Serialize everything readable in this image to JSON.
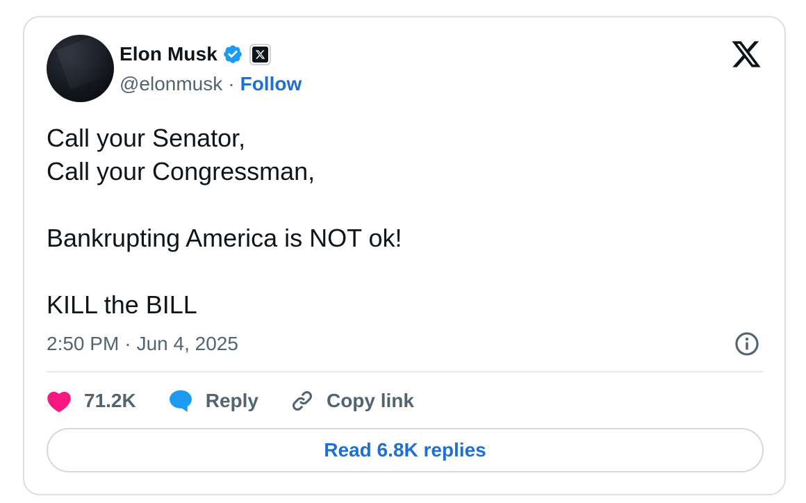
{
  "author": {
    "name": "Elon Musk",
    "handle": "@elonmusk",
    "separator": "·",
    "follow_label": "Follow"
  },
  "icons": {
    "verified": "verified-badge-icon",
    "affiliate": "x-affiliate-badge-icon",
    "platform": "x-logo-icon",
    "info": "info-icon",
    "like": "heart-icon",
    "reply": "speech-bubble-icon",
    "copy": "link-icon"
  },
  "tweet": {
    "lines": [
      "Call your Senator,",
      "Call your Congressman,",
      "",
      "Bankrupting America is NOT ok!",
      "",
      "KILL the BILL"
    ],
    "time": "2:50 PM",
    "date_separator": "·",
    "date": "Jun 4, 2025"
  },
  "actions": {
    "likes": "71.2K",
    "reply_label": "Reply",
    "copy_label": "Copy link"
  },
  "replies_button": "Read 6.8K replies",
  "colors": {
    "accent": "#1d6fd1",
    "verified": "#1d9bf0",
    "like": "#f91880",
    "muted": "#536471",
    "text": "#0f1419"
  }
}
